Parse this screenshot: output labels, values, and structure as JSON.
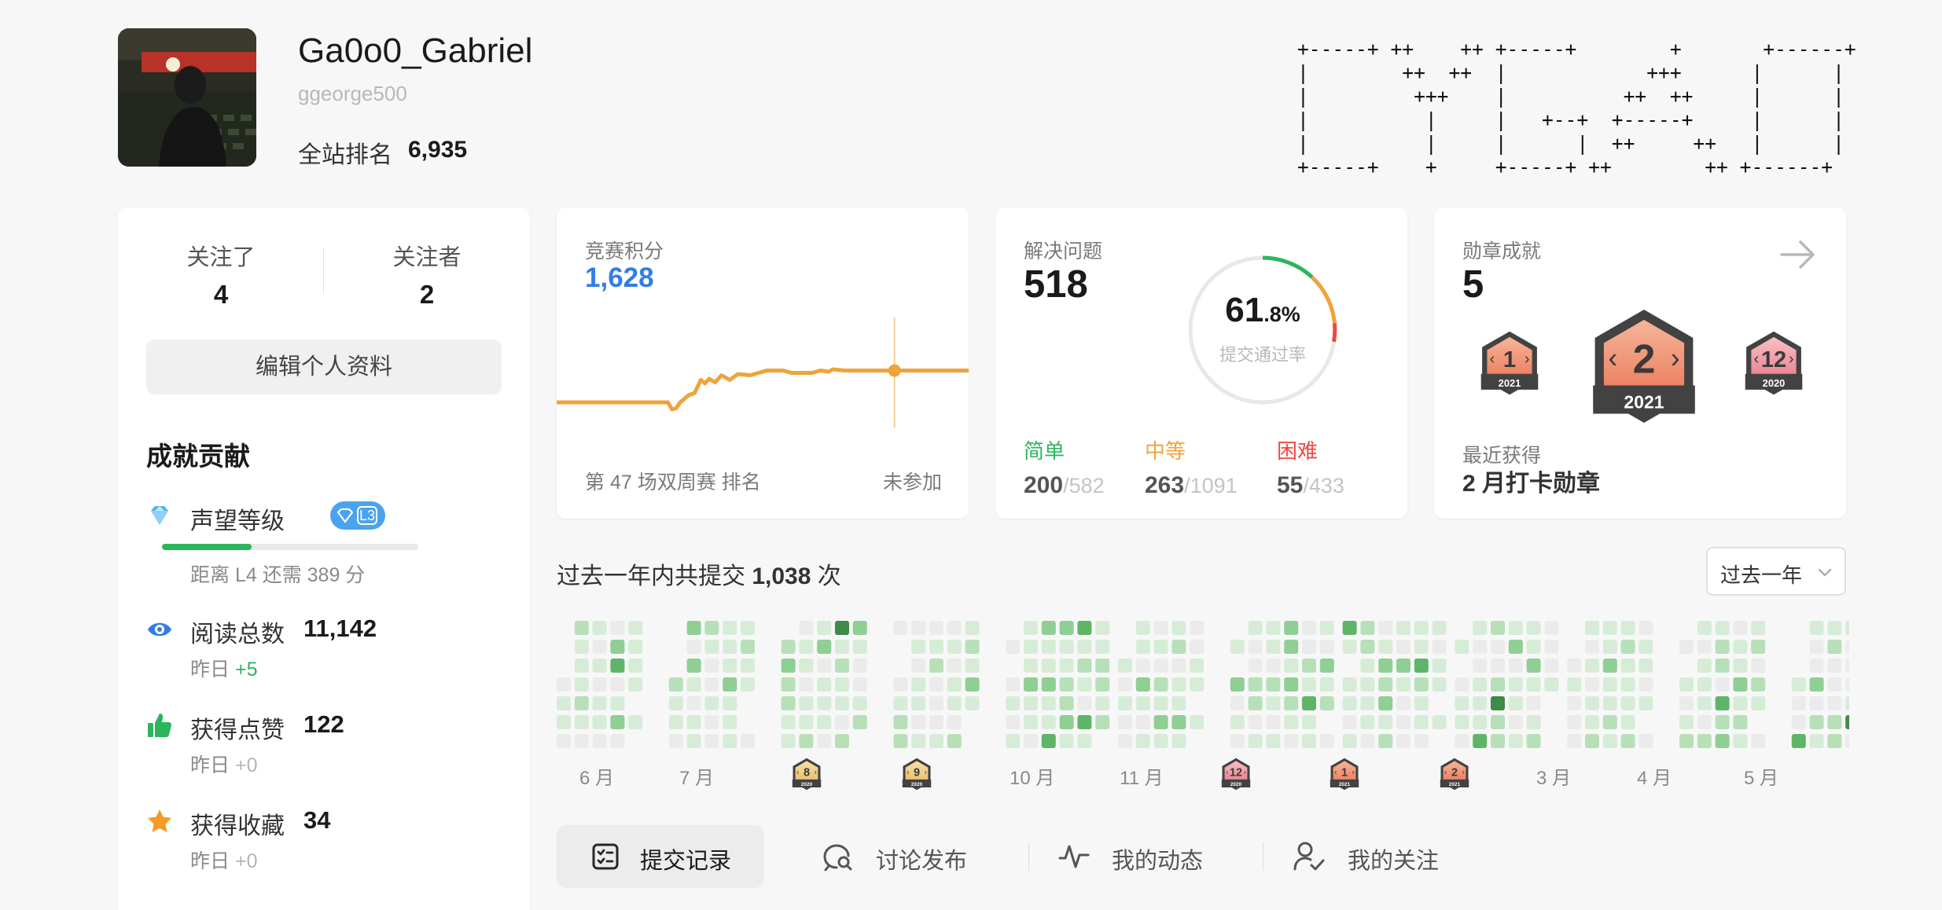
{
  "profile": {
    "display_name": "Ga0o0_Gabriel",
    "username": "ggeorge500",
    "global_rank_label": "全站排名",
    "global_rank_value": "6,935",
    "ascii_art": "+-----+ ++    ++ +-----+        +       +------+\n|        ++  ++  |            +++      |      |\n|         +++    |          ++  ++     |      |\n|          |     |   +--+  +-----+     |      |\n|          |     |      |  ++     ++   |      |\n+-----+    +     +-----+ ++        ++ +------+"
  },
  "social": {
    "following_label": "关注了",
    "following_count": "4",
    "followers_label": "关注者",
    "followers_count": "2",
    "edit_button": "编辑个人资料"
  },
  "achievements": {
    "title": "成就贡献",
    "reputation": {
      "label": "声望等级",
      "level": "L3",
      "progress": 0.35,
      "sub": "距离 L4 还需 389 分"
    },
    "views": {
      "label": "阅读总数",
      "value": "11,142",
      "sub_prefix": "昨日",
      "sub_delta": "+5"
    },
    "likes": {
      "label": "获得点赞",
      "value": "122",
      "sub_prefix": "昨日",
      "sub_delta": "+0"
    },
    "favorites": {
      "label": "获得收藏",
      "value": "34",
      "sub_prefix": "昨日",
      "sub_delta": "+0"
    }
  },
  "contest": {
    "label": "竞赛积分",
    "rating": "1,628",
    "event_text": "第 47 场双周赛  排名",
    "status": "未参加",
    "color": "#f0a33a",
    "chart_data": {
      "type": "line",
      "points": [
        [
          0,
          0.72
        ],
        [
          0.27,
          0.72
        ],
        [
          0.28,
          0.78
        ],
        [
          0.29,
          0.77
        ],
        [
          0.3,
          0.72
        ],
        [
          0.31,
          0.69
        ],
        [
          0.32,
          0.66
        ],
        [
          0.335,
          0.64
        ],
        [
          0.35,
          0.53
        ],
        [
          0.36,
          0.56
        ],
        [
          0.37,
          0.52
        ],
        [
          0.385,
          0.55
        ],
        [
          0.4,
          0.49
        ],
        [
          0.42,
          0.53
        ],
        [
          0.44,
          0.48
        ],
        [
          0.47,
          0.49
        ],
        [
          0.49,
          0.47
        ],
        [
          0.51,
          0.45
        ],
        [
          0.55,
          0.45
        ],
        [
          0.57,
          0.47
        ],
        [
          0.62,
          0.47
        ],
        [
          0.64,
          0.45
        ],
        [
          0.66,
          0.46
        ],
        [
          0.67,
          0.44
        ],
        [
          0.7,
          0.45
        ],
        [
          0.82,
          0.45
        ],
        [
          1,
          0.45
        ]
      ],
      "marker_at": 0.82
    }
  },
  "solved": {
    "label": "解决问题",
    "count": "518",
    "rate_int": "61",
    "rate_dec": ".8%",
    "rate_caption": "提交通过率",
    "easy": {
      "label": "简单",
      "solved": "200",
      "total": "/582",
      "color": "#2db55d"
    },
    "medium": {
      "label": "中等",
      "solved": "263",
      "total": "/1091",
      "color": "#f0a33a"
    },
    "hard": {
      "label": "困难",
      "solved": "55",
      "total": "/433",
      "color": "#ef4743"
    }
  },
  "badges": {
    "label": "勋章成就",
    "count": "5",
    "recent_label": "最近获得",
    "recent_name": "2 月打卡勋章",
    "items": [
      {
        "month": "1",
        "year": "2021"
      },
      {
        "month": "2",
        "year": "2021"
      },
      {
        "month": "12",
        "year": "2020"
      }
    ]
  },
  "heatmap": {
    "title_prefix": "过去一年内共提交",
    "title_count": "1,038",
    "title_suffix": "次",
    "range_label": "过去一年",
    "months": [
      "6 月",
      "7 月",
      "10 月",
      "11 月",
      "3 月",
      "4 月",
      "5 月"
    ],
    "badges": [
      {
        "month": "8",
        "year": "2020"
      },
      {
        "month": "9",
        "year": "2020"
      },
      {
        "month": "12",
        "year": "2020"
      },
      {
        "month": "1",
        "year": "2021"
      },
      {
        "month": "2",
        "year": "2021"
      }
    ]
  },
  "tabs": [
    {
      "label": "提交记录",
      "icon": "list-check-icon"
    },
    {
      "label": "讨论发布",
      "icon": "chat-search-icon"
    },
    {
      "label": "我的动态",
      "icon": "activity-icon"
    },
    {
      "label": "我的关注",
      "icon": "user-check-icon"
    }
  ]
}
